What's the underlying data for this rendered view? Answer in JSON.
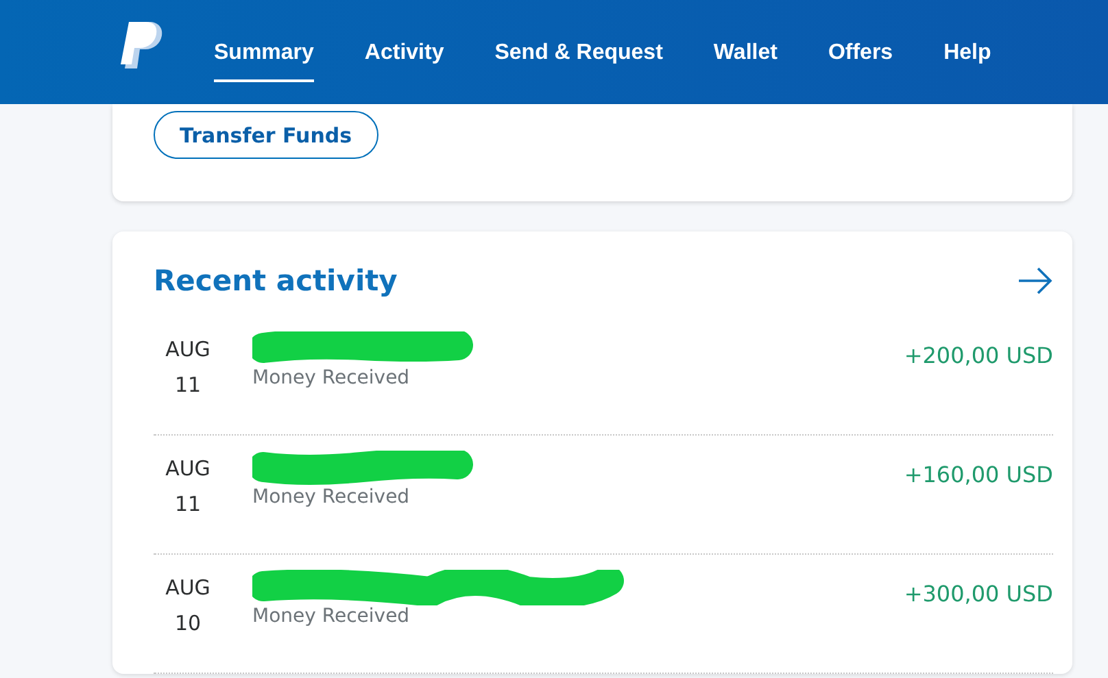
{
  "nav": {
    "items": [
      {
        "label": "Summary",
        "selected": true
      },
      {
        "label": "Activity",
        "selected": false
      },
      {
        "label": "Send & Request",
        "selected": false
      },
      {
        "label": "Wallet",
        "selected": false
      },
      {
        "label": "Offers",
        "selected": false
      },
      {
        "label": "Help",
        "selected": false
      }
    ]
  },
  "balance_card": {
    "button": "Transfer Funds"
  },
  "recent_activity": {
    "title": "Recent activity",
    "rows": [
      {
        "month": "AUG",
        "day": "11",
        "description": "Money Received",
        "amount": "+200,00 USD"
      },
      {
        "month": "AUG",
        "day": "11",
        "description": "Money Received",
        "amount": "+160,00 USD"
      },
      {
        "month": "AUG",
        "day": "10",
        "description": "Money Received",
        "amount": "+300,00 USD"
      }
    ]
  }
}
